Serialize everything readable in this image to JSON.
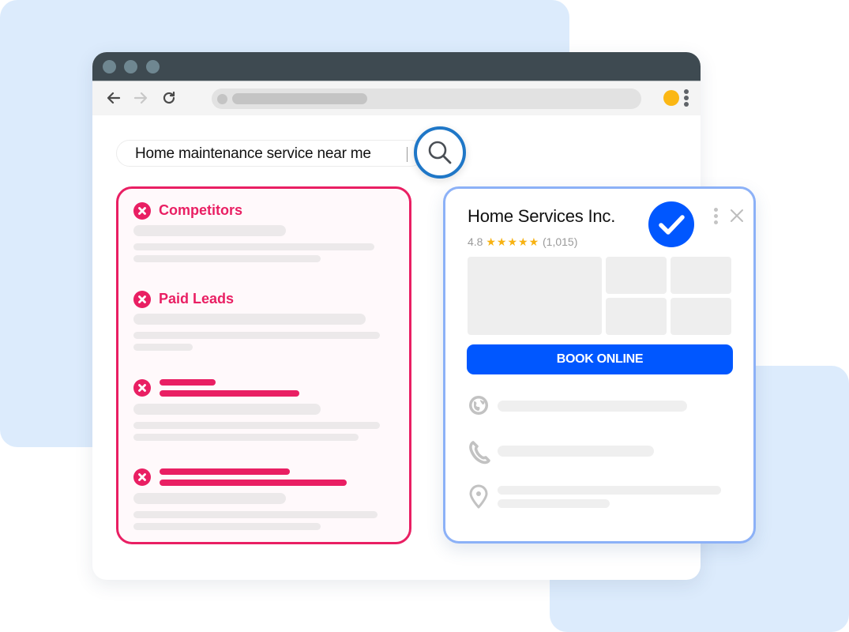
{
  "browser": {
    "window_controls": [
      "close-dot",
      "minimize-dot",
      "maximize-dot"
    ],
    "nav": {
      "back_icon": "arrow-left-icon",
      "forward_icon": "arrow-right-icon",
      "reload_icon": "reload-icon"
    },
    "address_bar": {
      "value": ""
    },
    "colors": {
      "titlebar": "#3e4a51",
      "profile": "#fbb714"
    }
  },
  "search": {
    "query": "Home maintenance service near me",
    "button_icon": "search-icon",
    "accent": "#1f77c7"
  },
  "ads_panel": {
    "accent": "#e91f63",
    "items": [
      {
        "title": "Competitors",
        "icon": "x-circle-icon"
      },
      {
        "title": "Paid Leads",
        "icon": "x-circle-icon"
      },
      {
        "title": "",
        "icon": "x-circle-icon"
      },
      {
        "title": "",
        "icon": "x-circle-icon"
      }
    ]
  },
  "business_card": {
    "name": "Home Services Inc.",
    "verified_icon": "verified-check-icon",
    "rating": "4.8",
    "stars": "★★★★★",
    "review_count": "(1,015)",
    "book_button": "BOOK ONLINE",
    "accent": "#0057ff",
    "border": "#8cb1f7",
    "info_rows": [
      {
        "icon": "globe-icon"
      },
      {
        "icon": "phone-icon"
      },
      {
        "icon": "location-pin-icon"
      }
    ]
  }
}
